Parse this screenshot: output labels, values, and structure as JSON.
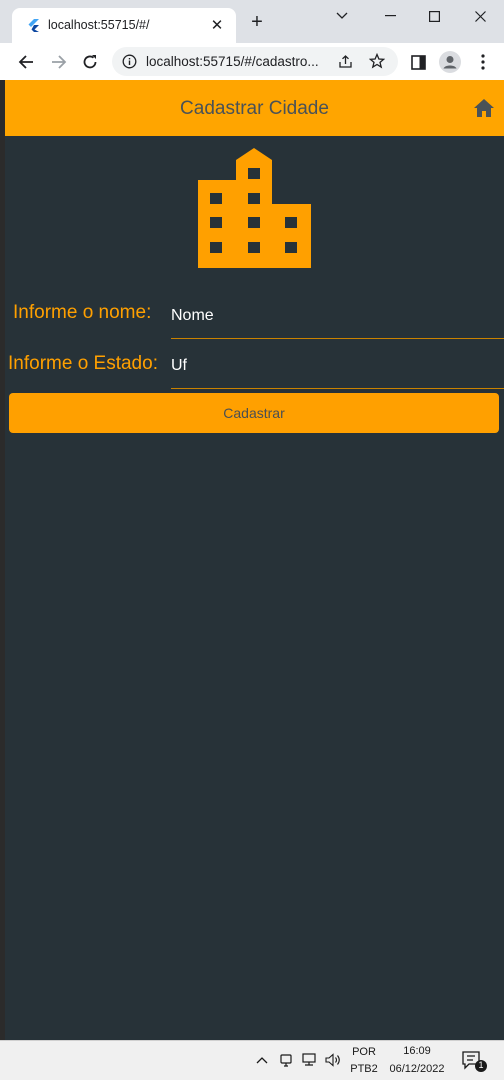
{
  "browser": {
    "tab_title": "localhost:55715/#/",
    "tab_close": "✕",
    "new_tab": "+",
    "url": "localhost:55715/#/cadastro..."
  },
  "app": {
    "title": "Cadastrar Cidade",
    "home_icon": "home-icon",
    "hero_icon": "building-icon",
    "accent": "#ffa500",
    "background": "#273238"
  },
  "form": {
    "name_label": "Informe o nome:",
    "name_placeholder": "Nome",
    "state_label": "Informe o Estado:",
    "state_placeholder": "Uf",
    "submit_label": "Cadastrar"
  },
  "taskbar": {
    "lang_top": "POR",
    "lang_bottom": "PTB2",
    "time": "16:09",
    "date": "06/12/2022",
    "notification_count": "1"
  }
}
